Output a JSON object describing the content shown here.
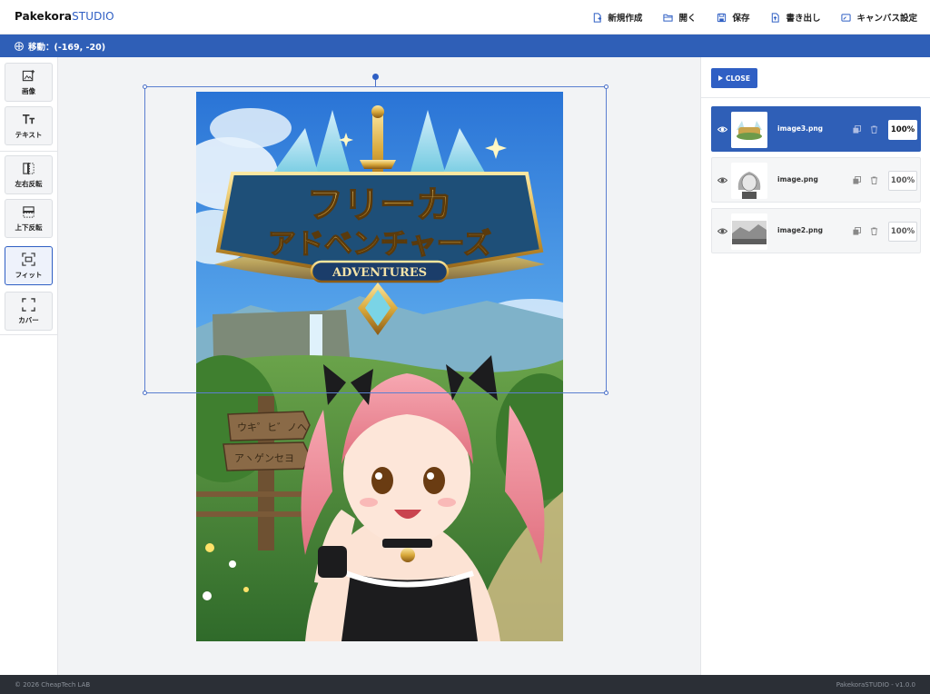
{
  "header": {
    "brand_primary": "Pakekora",
    "brand_secondary": "STUDIO",
    "menu": [
      {
        "label": "新規作成",
        "icon": "new-file-icon"
      },
      {
        "label": "開く",
        "icon": "folder-open-icon"
      },
      {
        "label": "保存",
        "icon": "save-icon"
      },
      {
        "label": "書き出し",
        "icon": "export-icon"
      },
      {
        "label": "キャンバス設定",
        "icon": "canvas-settings-icon"
      }
    ]
  },
  "status": {
    "icon": "move-icon",
    "text": "移動：(-169, -20)"
  },
  "toolbar": {
    "tools": [
      {
        "label": "画像",
        "icon": "add-image-icon"
      },
      {
        "label": "テキスト",
        "icon": "text-icon"
      },
      {
        "label": "左右反転",
        "icon": "flip-horizontal-icon"
      },
      {
        "label": "上下反転",
        "icon": "flip-vertical-icon"
      },
      {
        "label": "フィット",
        "icon": "fit-icon",
        "active": true
      },
      {
        "label": "カバー",
        "icon": "cover-icon"
      }
    ]
  },
  "artwork": {
    "title_line1": "フリーカ",
    "title_line2": "アドベンチャーズ",
    "subtitle": "ADVENTURES",
    "sign_line1": "ウキ゜ヒ゛ノヘ",
    "sign_line2": "アヽゲンセヨ"
  },
  "panel": {
    "close_label": "CLOSE",
    "layers": [
      {
        "name": "image3.png",
        "opacity": "100%",
        "selected": true
      },
      {
        "name": "image.png",
        "opacity": "100%",
        "selected": false
      },
      {
        "name": "image2.png",
        "opacity": "100%",
        "selected": false
      }
    ]
  },
  "footer": {
    "left": "© 2026 CheapTech LAB",
    "right": "PakekoraSTUDIO - v1.0.0"
  },
  "colors": {
    "accent": "#2f5fc4",
    "statusbar": "#2f5fb7",
    "footer": "#2b2f36"
  }
}
